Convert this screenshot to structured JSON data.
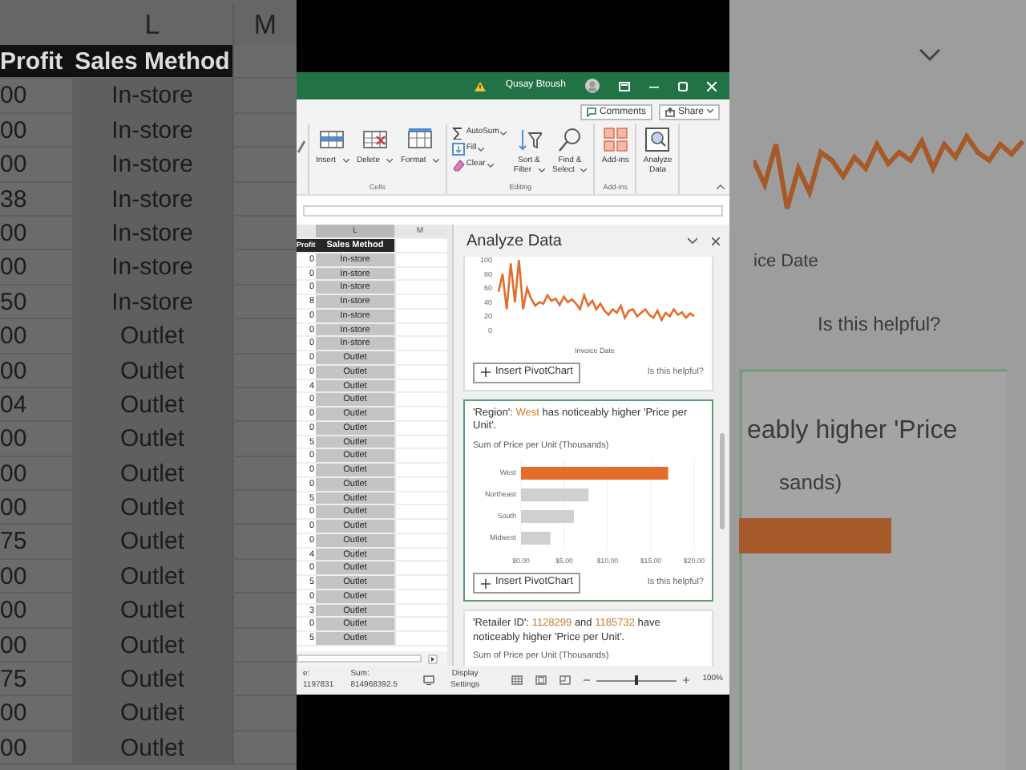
{
  "background_left": {
    "columns": [
      "L",
      "M"
    ],
    "headers": [
      "Profit",
      "Sales Method"
    ],
    "rows": [
      {
        "profit": "00",
        "method": "In-store"
      },
      {
        "profit": "00",
        "method": "In-store"
      },
      {
        "profit": "00",
        "method": "In-store"
      },
      {
        "profit": "38",
        "method": "In-store"
      },
      {
        "profit": "00",
        "method": "In-store"
      },
      {
        "profit": "00",
        "method": "In-store"
      },
      {
        "profit": "50",
        "method": "In-store"
      },
      {
        "profit": "00",
        "method": "Outlet"
      },
      {
        "profit": "00",
        "method": "Outlet"
      },
      {
        "profit": "04",
        "method": "Outlet"
      },
      {
        "profit": "00",
        "method": "Outlet"
      },
      {
        "profit": "00",
        "method": "Outlet"
      },
      {
        "profit": "00",
        "method": "Outlet"
      },
      {
        "profit": "75",
        "method": "Outlet"
      },
      {
        "profit": "00",
        "method": "Outlet"
      },
      {
        "profit": "00",
        "method": "Outlet"
      },
      {
        "profit": "00",
        "method": "Outlet"
      },
      {
        "profit": "75",
        "method": "Outlet"
      },
      {
        "profit": "00",
        "method": "Outlet"
      },
      {
        "profit": "00",
        "method": "Outlet"
      }
    ]
  },
  "title_bar": {
    "user": "Qusay Btoush"
  },
  "actions": [
    "Comments",
    "Share"
  ],
  "ribbon": {
    "groups": [
      {
        "label": "Cells",
        "buttons": [
          {
            "kind": "large",
            "lines": [
              "Insert"
            ],
            "dropdown": true
          },
          {
            "kind": "large",
            "lines": [
              "Delete"
            ],
            "dropdown": true
          },
          {
            "kind": "large",
            "lines": [
              "Format"
            ],
            "dropdown": true
          }
        ]
      },
      {
        "label": "Editing",
        "buttons": [
          {
            "kind": "small",
            "lines": [
              "AutoSum"
            ],
            "dropdown": true
          },
          {
            "kind": "small",
            "lines": [
              "Fill"
            ],
            "dropdown": true
          },
          {
            "kind": "small",
            "lines": [
              "Clear"
            ],
            "dropdown": true
          },
          {
            "kind": "large",
            "lines": [
              "Sort &",
              "Filter"
            ],
            "dropdown": true
          },
          {
            "kind": "large",
            "lines": [
              "Find &",
              "Select"
            ],
            "dropdown": true
          }
        ]
      },
      {
        "label": "Add-ins",
        "buttons": [
          {
            "kind": "large",
            "lines": [
              "Add-ins"
            ],
            "dropdown": false
          }
        ]
      },
      {
        "buttons": [
          {
            "kind": "large",
            "lines": [
              "Analyze",
              "Data"
            ],
            "dropdown": false
          }
        ]
      }
    ]
  },
  "sheet": {
    "columns": [
      {
        "label": "L",
        "selected": true
      },
      {
        "label": "M",
        "selected": false
      }
    ],
    "headers": [
      "Profit",
      "Sales Method"
    ],
    "rows": [
      {
        "profit": "0",
        "method": "In-store"
      },
      {
        "profit": "0",
        "method": "In-store"
      },
      {
        "profit": "0",
        "method": "In-store"
      },
      {
        "profit": "8",
        "method": "In-store"
      },
      {
        "profit": "0",
        "method": "In-store"
      },
      {
        "profit": "0",
        "method": "In-store"
      },
      {
        "profit": "0",
        "method": "In-store"
      },
      {
        "profit": "0",
        "method": "Outlet"
      },
      {
        "profit": "0",
        "method": "Outlet"
      },
      {
        "profit": "4",
        "method": "Outlet"
      },
      {
        "profit": "0",
        "method": "Outlet"
      },
      {
        "profit": "0",
        "method": "Outlet"
      },
      {
        "profit": "0",
        "method": "Outlet"
      },
      {
        "profit": "5",
        "method": "Outlet"
      },
      {
        "profit": "0",
        "method": "Outlet"
      },
      {
        "profit": "0",
        "method": "Outlet"
      },
      {
        "profit": "0",
        "method": "Outlet"
      },
      {
        "profit": "5",
        "method": "Outlet"
      },
      {
        "profit": "0",
        "method": "Outlet"
      },
      {
        "profit": "0",
        "method": "Outlet"
      },
      {
        "profit": "0",
        "method": "Outlet"
      },
      {
        "profit": "4",
        "method": "Outlet"
      },
      {
        "profit": "0",
        "method": "Outlet"
      },
      {
        "profit": "5",
        "method": "Outlet"
      },
      {
        "profit": "0",
        "method": "Outlet"
      },
      {
        "profit": "3",
        "method": "Outlet"
      },
      {
        "profit": "0",
        "method": "Outlet"
      },
      {
        "profit": "5",
        "method": "Outlet"
      }
    ]
  },
  "analyze_pane": {
    "title": "Analyze Data",
    "cards": [
      {
        "kind": "line",
        "selected": false,
        "chart_data": {
          "type": "line",
          "xlabel": "Invoice Date",
          "ylim": [
            0,
            100
          ],
          "yticks": [
            0,
            20,
            40,
            60,
            80,
            100
          ],
          "series": [
            {
              "color": "#e46c2c",
              "values": [
                55,
                80,
                30,
                95,
                40,
                100,
                30,
                60,
                45,
                35,
                40,
                38,
                50,
                42,
                45,
                36,
                48,
                40,
                44,
                38,
                30,
                50,
                35,
                42,
                30,
                38,
                28,
                22,
                30,
                25,
                35,
                18,
                28,
                30,
                20,
                25,
                30,
                22,
                18,
                28,
                15,
                25,
                20,
                30,
                22,
                26,
                18,
                24,
                20
              ]
            }
          ]
        },
        "button": "Insert PivotChart",
        "feedback": "Is this helpful?"
      },
      {
        "kind": "bar",
        "selected": true,
        "sentence": [
          {
            "text": "'Region': ",
            "highlight": false
          },
          {
            "text": "West",
            "highlight": true
          },
          {
            "text": " has noticeably higher 'Price per Unit'.",
            "highlight": false
          }
        ],
        "subtitle": "Sum of Price per Unit (Thousands)",
        "chart_data": {
          "type": "bar",
          "orientation": "horizontal",
          "grid": true,
          "categories": [
            "West",
            "Northeast",
            "South",
            "Midwest"
          ],
          "xlim": [
            0,
            20
          ],
          "xticks": [
            {
              "value": 0,
              "label": "$0.00"
            },
            {
              "value": 5,
              "label": "$5.00"
            },
            {
              "value": 10,
              "label": "$10.00"
            },
            {
              "value": 15,
              "label": "$15.00"
            },
            {
              "value": 20,
              "label": "$20.00"
            }
          ],
          "series": [
            {
              "color": "#e46c2c",
              "values": [
                17,
                null,
                null,
                null
              ]
            },
            {
              "color": "#d0d0d0",
              "values": [
                null,
                7.8,
                6.1,
                3.4
              ]
            }
          ]
        },
        "button": "Insert PivotChart",
        "feedback": "Is this helpful?"
      },
      {
        "kind": "text",
        "selected": false,
        "sentence": [
          {
            "text": "'Retailer ID': ",
            "highlight": false
          },
          {
            "text": "1128299",
            "highlight": true
          },
          {
            "text": " and ",
            "highlight": false
          },
          {
            "text": "1185732",
            "highlight": true
          },
          {
            "text": " have noticeably higher 'Price per Unit'.",
            "highlight": false
          }
        ],
        "subtitle": "Sum of Price per Unit (Thousands)"
      }
    ]
  },
  "status_bar": {
    "count": "e: 1197831",
    "sum": "Sum: 814968392.5",
    "display_settings": "Display Settings",
    "zoom": "100%",
    "level": 0.5
  },
  "background_right": {
    "xlabel": "ice Date",
    "feedback": "Is this helpful?",
    "insight": "eably higher 'Price",
    "subtitle": "sands)"
  }
}
